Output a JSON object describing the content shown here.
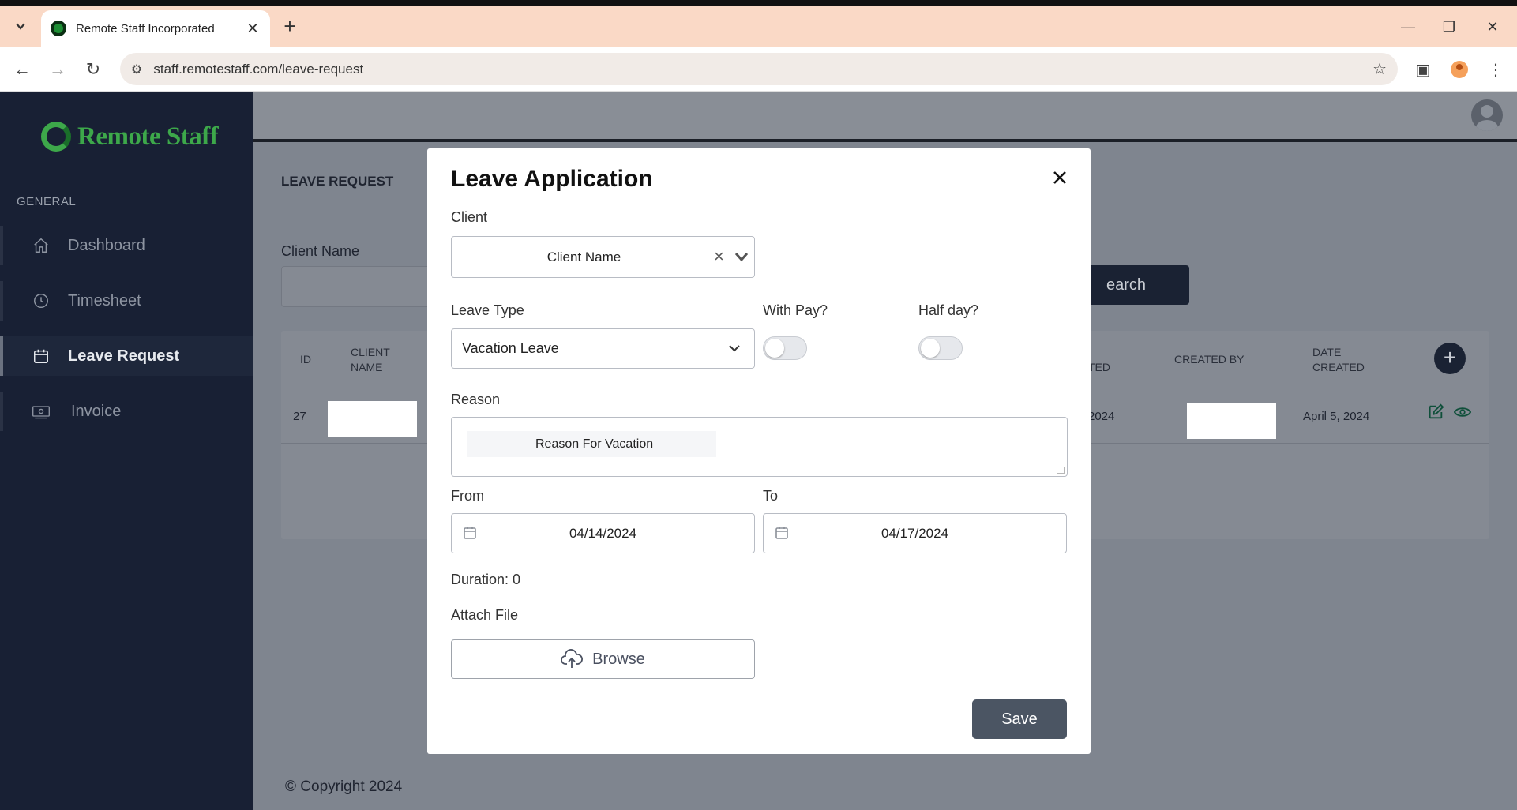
{
  "browser": {
    "tab_title": "Remote Staff Incorporated",
    "url": "staff.remotestaff.com/leave-request"
  },
  "sidebar": {
    "brand": "Remote Staff",
    "section": "GENERAL",
    "items": [
      {
        "label": "Dashboard",
        "icon": "home-icon"
      },
      {
        "label": "Timesheet",
        "icon": "clock-icon"
      },
      {
        "label": "Leave Request",
        "icon": "calendar-icon"
      },
      {
        "label": "Invoice",
        "icon": "money-icon"
      }
    ],
    "active": "Leave Request"
  },
  "page": {
    "title": "LEAVE REQUEST",
    "client_label": "Client Name",
    "search_label": "earch",
    "copyright": "© Copyright 2024"
  },
  "table": {
    "headers": {
      "id": "ID",
      "client_name_1": "CLIENT",
      "client_name_2": "NAME",
      "partial": "TED",
      "created_by": "CREATED BY",
      "date_created_1": "DATE",
      "date_created_2": "CREATED"
    },
    "row": {
      "id": "27",
      "partial_date": "2024",
      "date_created": "April 5, 2024"
    }
  },
  "modal": {
    "title": "Leave Application",
    "client_label": "Client",
    "client_value": "Client Name",
    "leave_type_label": "Leave Type",
    "leave_type_value": "Vacation Leave",
    "with_pay_label": "With Pay?",
    "half_day_label": "Half day?",
    "with_pay_on": false,
    "half_day_on": false,
    "reason_label": "Reason",
    "reason_value": "Reason For Vacation",
    "from_label": "From",
    "from_value": "04/14/2024",
    "to_label": "To",
    "to_value": "04/17/2024",
    "duration": "Duration: 0",
    "attach_label": "Attach File",
    "browse_label": "Browse",
    "save_label": "Save"
  },
  "colors": {
    "sidebar_bg": "#182034",
    "brand_green": "#3da84a",
    "save_button": "#4b5563",
    "overlay": "#7f858f"
  }
}
